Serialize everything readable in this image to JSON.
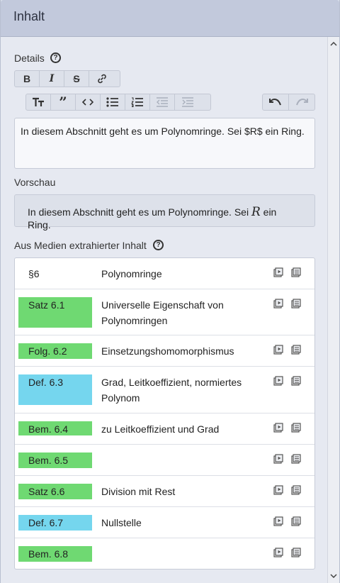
{
  "header": {
    "title": "Inhalt"
  },
  "details": {
    "label": "Details",
    "editor_text": "In diesem Abschnitt geht es um Polynomringe. Sei $R$ ein Ring."
  },
  "preview": {
    "label": "Vorschau",
    "text_before": "In diesem Abschnitt geht es um Polynomringe. Sei ",
    "math": "R",
    "text_after": " ein Ring."
  },
  "media": {
    "label": "Aus Medien extrahierter Inhalt",
    "rows": [
      {
        "tag": "§6",
        "name": "Polynomringe"
      },
      {
        "tag": "Satz 6.1",
        "name": "Universelle Eigenschaft von Polynomringen"
      },
      {
        "tag": "Folg. 6.2",
        "name": "Einsetzungshomomorphismus"
      },
      {
        "tag": "Def. 6.3",
        "name": "Grad, Leitkoeffizient, normiertes Polynom"
      },
      {
        "tag": "Bem. 6.4",
        "name": "zu Leitkoeffizient und Grad"
      },
      {
        "tag": "Bem. 6.5",
        "name": ""
      },
      {
        "tag": "Satz 6.6",
        "name": "Division mit Rest"
      },
      {
        "tag": "Def. 6.7",
        "name": "Nullstelle"
      },
      {
        "tag": "Bem. 6.8",
        "name": ""
      }
    ]
  },
  "colors": {
    "satz": "#6fd972",
    "folg": "#6fd972",
    "bem": "#6fd972",
    "def": "#75d6ee"
  }
}
